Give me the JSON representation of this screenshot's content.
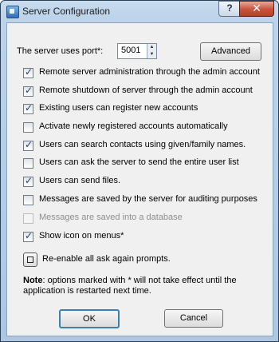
{
  "window": {
    "title": "Server Configuration",
    "help_label": "?",
    "close_label": "✕",
    "app_icon": "server-icon"
  },
  "port": {
    "label": "The server uses port*:",
    "value": "5001"
  },
  "buttons": {
    "advanced": "Advanced",
    "ok": "OK",
    "cancel": "Cancel"
  },
  "options": [
    {
      "label": "Remote server administration through the admin account",
      "checked": true,
      "enabled": true
    },
    {
      "label": "Remote shutdown of server through the admin account",
      "checked": true,
      "enabled": true
    },
    {
      "label": "Existing users can register new accounts",
      "checked": true,
      "enabled": true
    },
    {
      "label": "Activate newly registered accounts automatically",
      "checked": false,
      "enabled": true
    },
    {
      "label": "Users can search contacts using given/family names.",
      "checked": true,
      "enabled": true
    },
    {
      "label": "Users can ask the server to send the entire user list",
      "checked": false,
      "enabled": true
    },
    {
      "label": "Users can send files.",
      "checked": true,
      "enabled": true
    },
    {
      "label": "Messages are saved by the server for auditing purposes",
      "checked": false,
      "enabled": true
    },
    {
      "label": "Messages are saved into a database",
      "checked": false,
      "enabled": false
    },
    {
      "label": "Show icon on menus*",
      "checked": true,
      "enabled": true
    }
  ],
  "reenable": {
    "label": "Re-enable all ask again prompts."
  },
  "note": {
    "bold": "Note",
    "text": ": options marked with * will not take effect until the application is restarted next time."
  }
}
